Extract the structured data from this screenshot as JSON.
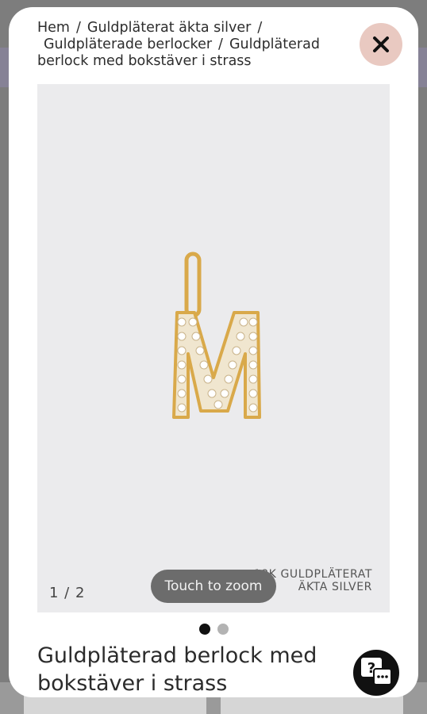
{
  "breadcrumb": {
    "home": "Hem",
    "level1": "Guldpläterat äkta silver",
    "level2": "Guldpläterade berlocker",
    "current": "Guldpläterad berlock med bokstäver i strass"
  },
  "gallery": {
    "counter": "1 / 2",
    "zoom_hint": "Touch to zoom",
    "watermark_line1": "18K GULDPLÄTERAT",
    "watermark_line2": "ÄKTA SILVER",
    "image_alt_letter": "M"
  },
  "product": {
    "title": "Guldpläterad berlock med bokstäver i strass"
  },
  "icons": {
    "close": "close-icon",
    "help": "help-chat-icon"
  },
  "colors": {
    "close_bg": "#e9c9c1",
    "gold": "#d9a94a",
    "gallery_bg": "#ebebed"
  }
}
